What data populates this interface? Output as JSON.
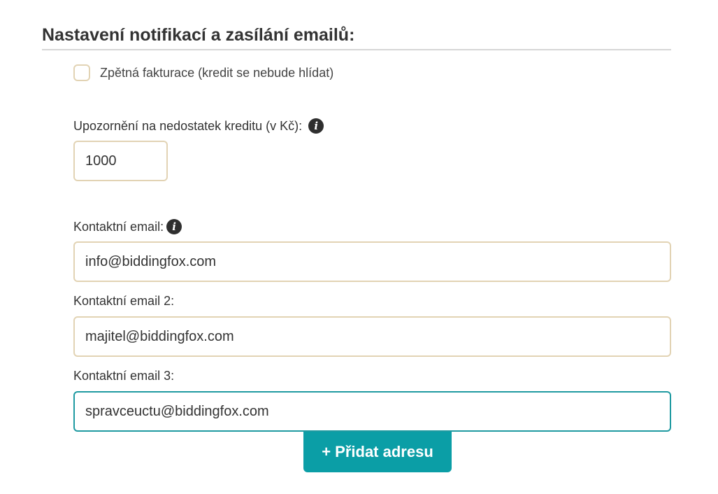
{
  "section": {
    "title": "Nastavení notifikací a zasílání emailů:"
  },
  "reverse_billing": {
    "label": "Zpětná fakturace (kredit se nebude hlídat)",
    "checked": false
  },
  "credit_warning": {
    "label": "Upozornění na nedostatek kreditu (v Kč):",
    "value": "1000"
  },
  "contact_emails": [
    {
      "label": "Kontaktní email:",
      "value": "info@biddingfox.com"
    },
    {
      "label": "Kontaktní email 2:",
      "value": "majitel@biddingfox.com"
    },
    {
      "label": "Kontaktní email 3:",
      "value": "spravceuctu@biddingfox.com"
    }
  ],
  "add_button": {
    "label": "+ Přidat adresu"
  },
  "icons": {
    "info": "info-icon"
  },
  "colors": {
    "accent": "#0b9ea6",
    "input_border": "#e2d3b4",
    "focused_border": "#1f9aa1",
    "text": "#333333",
    "info_icon_bg": "#2f2f2f"
  }
}
